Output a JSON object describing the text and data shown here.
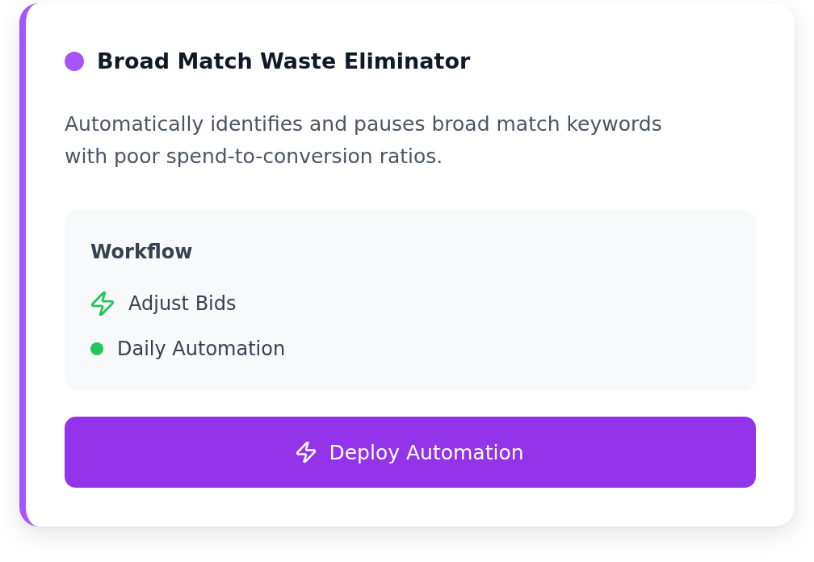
{
  "card": {
    "title": "Broad Match Waste Eliminator",
    "description": "Automatically identifies and pauses broad match keywords with poor spend-to-conversion ratios.",
    "workflow": {
      "heading": "Workflow",
      "items": [
        {
          "kind": "action",
          "label": "Adjust Bids"
        },
        {
          "kind": "schedule",
          "label": "Daily Automation"
        }
      ]
    },
    "button": {
      "label": "Deploy Automation"
    }
  }
}
